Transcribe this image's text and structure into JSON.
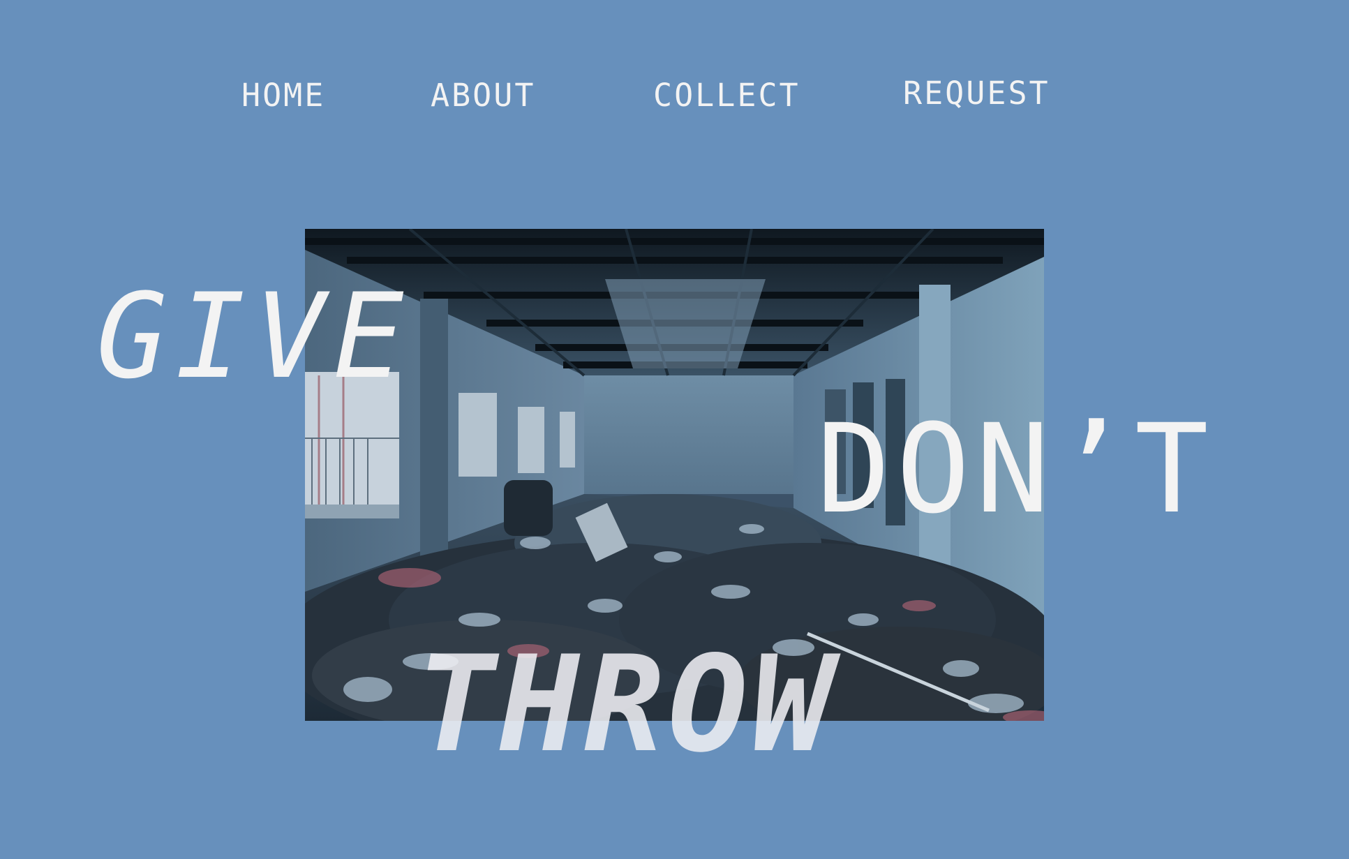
{
  "nav": {
    "items": [
      {
        "label": "HOME"
      },
      {
        "label": "ABOUT"
      },
      {
        "label": "COLLECT"
      },
      {
        "label": "REQUEST"
      }
    ]
  },
  "hero": {
    "line1": "GIVE",
    "line2": "DON’T",
    "line3": "THROW"
  },
  "colors": {
    "background": "#6790bc",
    "text": "#f3f3f3"
  }
}
